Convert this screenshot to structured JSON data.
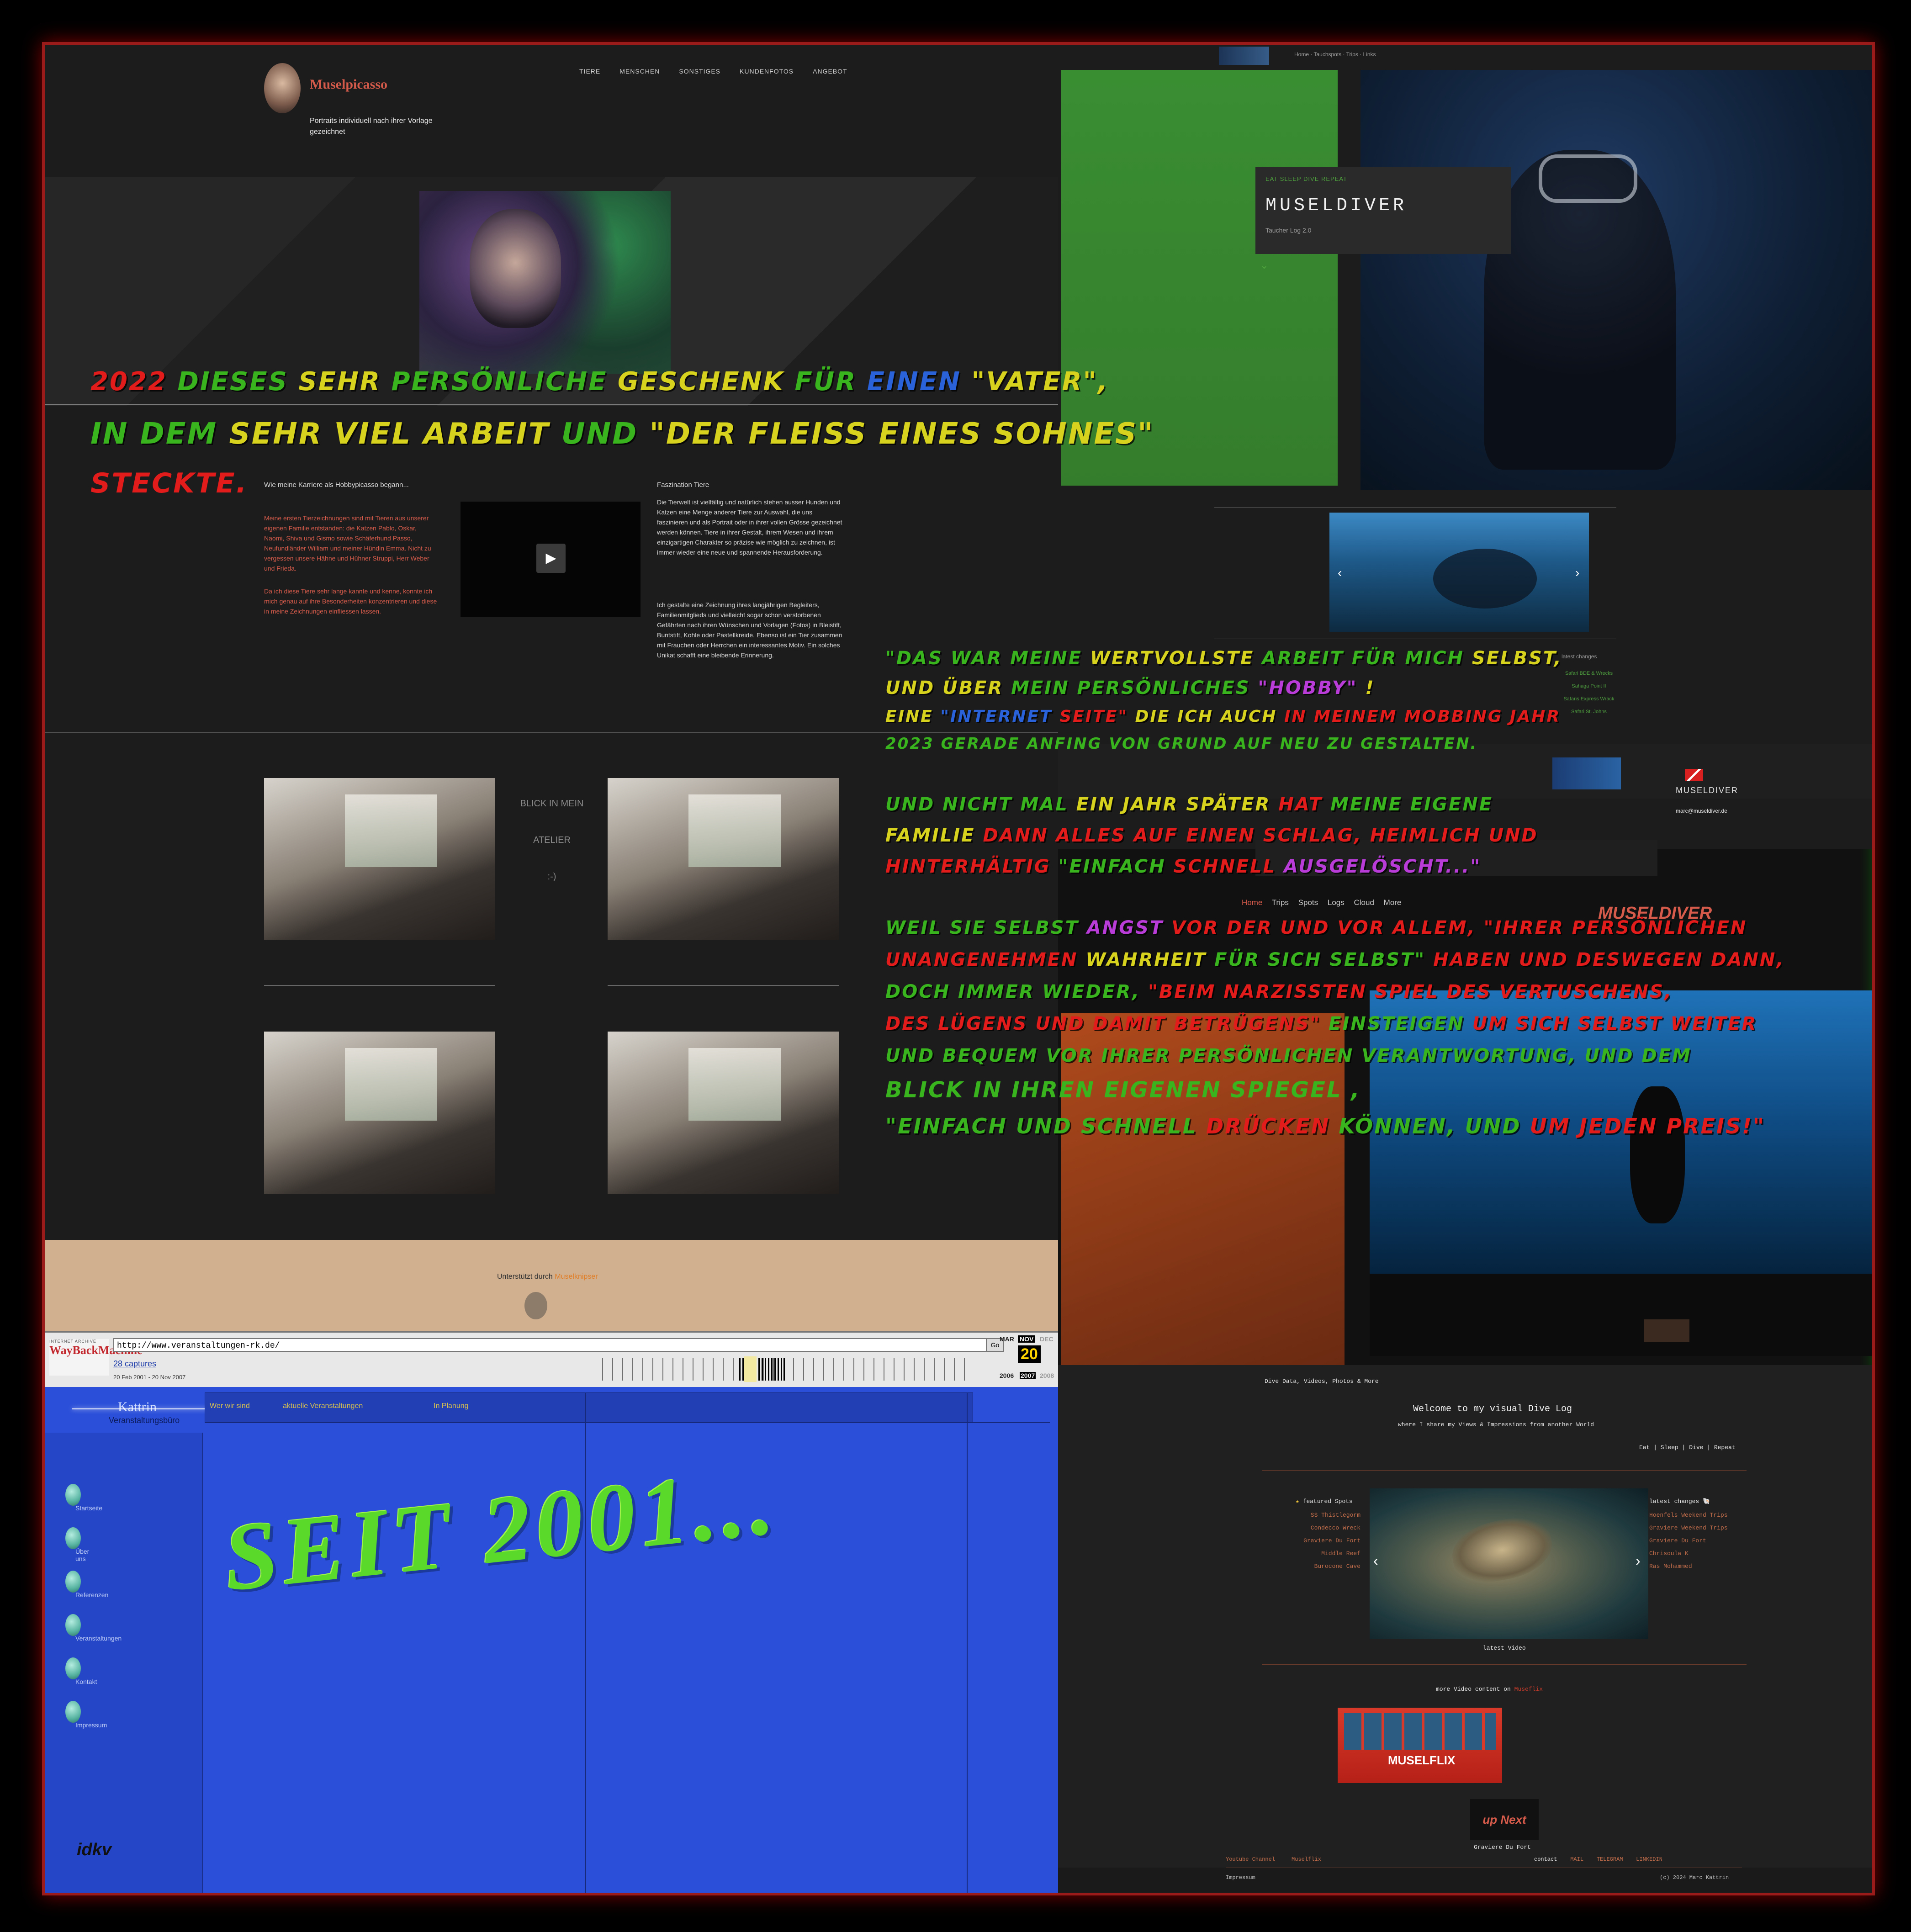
{
  "muselpicasso": {
    "brand": "Muselpicasso",
    "tagline": "Portraits individuell nach ihrer Vorlage gezeichnet",
    "nav": [
      "TIERE",
      "MENSCHEN",
      "SONSTIGES",
      "KUNDENFOTOS",
      "ANGEBOT"
    ],
    "col1_heading": "Wie meine Karriere als Hobbypicasso begann...",
    "col1_p1": "Meine ersten Tierzeichnungen sind mit Tieren aus unserer eigenen Familie entstanden: die Katzen Pablo, Oskar, Naomi, Shiva und Gismo sowie Schäferhund Passo, Neufundländer William und meiner Hündin Emma. Nicht zu vergessen unsere Hähne und Hühner Struppi, Herr Weber und Frieda.",
    "col1_p2": "Da ich diese Tiere sehr lange kannte und kenne, konnte ich mich genau auf ihre Besonderheiten konzentrieren und diese in meine Zeichnungen einfliessen lassen.",
    "col2_heading": "Faszination Tiere",
    "col2_p1": "Die Tierwelt ist vielfältig und natürlich stehen ausser Hunden und Katzen eine Menge anderer Tiere zur Auswahl, die uns faszinieren und als Portrait oder in ihrer vollen Grösse gezeichnet werden können. Tiere in ihrer Gestalt, ihrem Wesen und ihrem einzigartigen Charakter so präzise wie möglich zu zeichnen, ist immer wieder eine neue und spannende Herausforderung.",
    "col2_p2": "Ich gestalte eine Zeichnung ihres langjährigen Begleiters, Familienmitglieds und vielleicht sogar schon verstorbenen Gefährten nach ihren Wünschen und Vorlagen (Fotos) in Bleistift, Buntstift, Kohle oder Pastellkreide. Ebenso ist ein Tier zusammen mit Frauchen oder Herrchen ein interessantes Motiv. Ein solches Unikat schafft eine bleibende Erinnerung.",
    "atelier_line1": "BLICK IN MEIN",
    "atelier_line2": "ATELIER",
    "atelier_line3": ":-)",
    "supported_by": "Unterstützt durch",
    "supported_link": "Muselknipser"
  },
  "wayback": {
    "archive_label": "INTERNET ARCHIVE",
    "logo": "WayBackMachine",
    "url": "http://www.veranstaltungen-rk.de/",
    "go": "Go",
    "captures": "28 captures",
    "dates": "20 Feb 2001 - 20 Nov 2007",
    "months": [
      "MAR",
      "NOV",
      "DEC"
    ],
    "day": "20",
    "years": [
      "2006",
      "2007",
      "2008"
    ]
  },
  "blue_site": {
    "logo_name": "Kattrin",
    "logo_sub": "Veranstaltungsbüro",
    "menu": [
      "Wer wir sind",
      "aktuelle Veranstaltungen",
      "In Planung"
    ],
    "left_items": [
      "Startseite",
      "Über uns",
      "Referenzen",
      "Veranstaltungen",
      "Kontakt",
      "Impressum"
    ],
    "overlay": "SEIT 2001...",
    "footer_logo": "idkv"
  },
  "museldiver": {
    "nav": [
      "Home",
      "Tauchspots",
      "Trips",
      "Links"
    ],
    "kicker": "EAT SLEEP DIVE REPEAT",
    "title": "MUSELDIVER",
    "subtitle": "Taucher Log 2.0",
    "latest_changes_label": "latest changes",
    "latest_changes": [
      "Safari BDE & Wrecks",
      "Sahaga Point II",
      "Safaris Express Wrack",
      "Safari St. Johns"
    ],
    "brand_small": "MUSELDIVER",
    "email": "marc@museldiver.de",
    "menu2": [
      "Home",
      "Trips",
      "Spots",
      "Logs",
      "Cloud",
      "More"
    ],
    "logo2": "MUSELDIVER"
  },
  "divelog": {
    "intro": "Dive Data, Videos, Photos & More",
    "welcome": "Welcome to my visual Dive Log",
    "welcome_sub": "where I share my Views & Impressions from another World",
    "motto": "Eat | Sleep | Dive | Repeat",
    "featured_label": "featured Spots",
    "featured": [
      "SS Thistlegorm",
      "Condecco Wreck",
      "Graviere Du Fort",
      "Middle Reef",
      "Burocone Cave"
    ],
    "latest_label": "latest changes",
    "latest": [
      "Hoenfels Weekend Trips",
      "Graviere Weekend Trips",
      "Graviere Du Fort",
      "Chrisoula K",
      "Ras Mohammed"
    ],
    "latest_video": "latest Video",
    "more_video": "more Video content on",
    "more_video_link": "Museflix",
    "museflix": "MUSELFLIX",
    "up_next": "up Next",
    "up_next_caption": "Graviere Du Fort",
    "footer_left": [
      "Youtube Channel",
      "Muselflix"
    ],
    "footer_contact": "contact",
    "footer_links": [
      "MAIL",
      "TELEGRAM",
      "LINKEDIN"
    ],
    "impressum": "Impressum",
    "copyright": "(c) 2024 Marc Kattrin"
  },
  "overlay_text": {
    "line1": [
      "2022",
      "DIESES",
      "SEHR",
      "PERSÖNLICHE",
      "GESCHENK",
      "FÜR",
      "EINEN",
      "\"VATER\","
    ],
    "line2": [
      "IN DEM",
      "SEHR VIEL ARBEIT",
      "UND",
      "\"DER FLEIß EINES SOHNES\""
    ],
    "line3": "STECKTE.",
    "r1": [
      "\"DAS WAR MEINE",
      "WERTVOLLSTE",
      "ARBEIT",
      "FÜR MICH",
      "SELBST,"
    ],
    "r2": [
      "UND ÜBER",
      "MEIN PERSÖNLICHES",
      "\"HOBBY\"",
      "!"
    ],
    "r3": [
      "EINE",
      "\"INTERNET",
      "SEITE\"",
      "DIE ICH AUCH",
      "IN MEINEM MOBBING JAHR"
    ],
    "r4": "2023 GERADE ANFING VON GRUND AUF NEU ZU GESTALTEN.",
    "r5": [
      "UND NICHT MAL",
      "EIN JAHR SPÄTER",
      "HAT",
      "MEINE EIGENE"
    ],
    "r6": [
      "FAMILIE",
      "DANN ALLES AUF EINEN SCHLAG, HEIMLICH UND"
    ],
    "r7": [
      "HINTERHÄLTIG",
      "\"EINFACH",
      "SCHNELL",
      "AUSGELÖSCHT...\""
    ],
    "r8": [
      "WEIL SIE SELBST",
      "ANGST",
      "VOR DER UND VOR ALLEM, \"IHRER PERSÖNLICHEN"
    ],
    "r9": [
      "UNANGENEHMEN",
      "WAHRHEIT",
      "FÜR SICH SELBST\"",
      "HABEN UND DESWEGEN DANN,"
    ],
    "r10": [
      "DOCH IMMER WIEDER,",
      "\"BEIM NARZISSTEN",
      "SPIEL DES VERTUSCHENS,"
    ],
    "r11": [
      "DES LÜGENS UND DAMIT BETRÜGENS\"",
      "EINSTEIGEN",
      "UM SICH SELBST WEITER"
    ],
    "r12": [
      "UND BEQUEM VOR IHRER PERSÖNLICHEN VERANTWORTUNG, UND DEM"
    ],
    "r13": "BLICK IN IHREN EIGENEN SPIEGEL ,",
    "r14": [
      "\"EINFACH UND SCHNELL",
      "DRÜCKEN",
      "KÖNNEN, UND",
      "UM JEDEN",
      "PREIS!\""
    ]
  }
}
